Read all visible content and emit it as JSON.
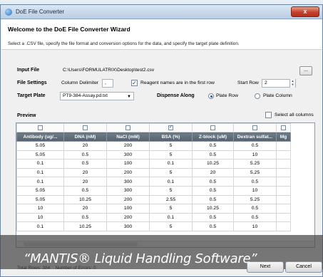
{
  "window": {
    "title": "DoE File Converter",
    "close_label": "x"
  },
  "header": {
    "title": "Welcome to the DoE File Converter Wizard",
    "subtitle": "Select a .CSV file, specify the file format and conversion options for the data, and specify the target plate definition."
  },
  "input_file": {
    "label": "Input File",
    "value": "C:\\Users\\FORMULATRIX\\Desktop\\test2.csv",
    "browse_label": "..."
  },
  "file_settings": {
    "label": "File Settings",
    "column_delimiter_label": "Column Delimiter",
    "column_delimiter_value": ",",
    "reagent_names_label": "Reagent names are in the first row",
    "reagent_names_checked": true,
    "start_row_label": "Start Row",
    "start_row_value": "2"
  },
  "target_plate": {
    "label": "Target Plate",
    "selected": "PT9-384-Assay.pd.txt"
  },
  "dispense_along": {
    "label": "Dispense Along",
    "options": [
      "Plate Row",
      "Plate Column"
    ],
    "selected": "Plate Row"
  },
  "preview": {
    "label": "Preview",
    "select_all_label": "Select all columns",
    "columns": [
      "Antibody (ug/...",
      "DNA (nM)",
      "NaCl (mM)",
      "BSA (%)",
      "Z-block (uM)",
      "Dextran sulfat...",
      "Mg"
    ],
    "column_checked": [
      false,
      false,
      false,
      true,
      false,
      false,
      false
    ],
    "rows": [
      [
        "5.05",
        "20",
        "200",
        "5",
        "0.5",
        "0.5",
        ""
      ],
      [
        "5.05",
        "0.5",
        "300",
        "5",
        "0.5",
        "10",
        ""
      ],
      [
        "0.1",
        "0.5",
        "100",
        "0.1",
        "10.25",
        "5.25",
        ""
      ],
      [
        "0.1",
        "20",
        "200",
        "5",
        "20",
        "5.25",
        ""
      ],
      [
        "0.1",
        "20",
        "300",
        "0.1",
        "0.5",
        "0.5",
        ""
      ],
      [
        "5.05",
        "0.5",
        "300",
        "5",
        "0.5",
        "10",
        ""
      ],
      [
        "5.05",
        "10.25",
        "200",
        "2.55",
        "0.5",
        "5.25",
        ""
      ],
      [
        "10",
        "20",
        "100",
        "5",
        "10.25",
        "0.5",
        ""
      ],
      [
        "10",
        "0.5",
        "200",
        "0.1",
        "0.5",
        "0.5",
        ""
      ],
      [
        "0.1",
        "10.25",
        "300",
        "5",
        "0.5",
        "10",
        ""
      ]
    ]
  },
  "status": {
    "total_rows": "Total Rows:  384",
    "number_errors": "Number of Errors:  0"
  },
  "buttons": {
    "next": "Next",
    "cancel": "Cancel"
  },
  "caption": "“MANTIS® Liquid Handling Software”",
  "colors": {
    "header_row": "#5f6b76",
    "accent": "#2256a8",
    "close": "#c6412d"
  }
}
